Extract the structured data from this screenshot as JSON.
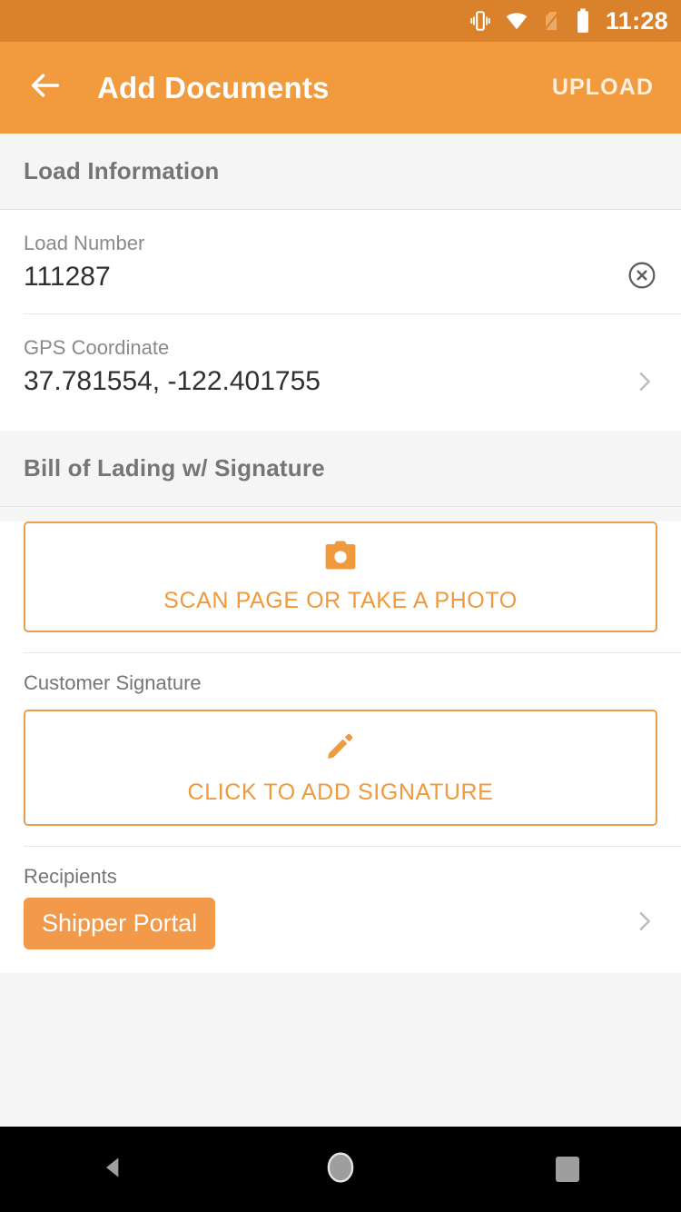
{
  "status_bar": {
    "time": "11:28",
    "icons": [
      "vibrate-icon",
      "wifi-icon",
      "no-sim-icon",
      "battery-icon"
    ],
    "background": "#d9822b"
  },
  "app_bar": {
    "back_icon": "back-arrow-icon",
    "title": "Add Documents",
    "action_label": "UPLOAD",
    "background": "#f29a3e"
  },
  "sections": {
    "load_information": {
      "header": "Load Information",
      "fields": [
        {
          "label": "Load Number",
          "value": "111287",
          "trailing_icon": "clear-circle-icon"
        },
        {
          "label": "GPS Coordinate",
          "value": "37.781554, -122.401755",
          "trailing_icon": "chevron-right-icon"
        }
      ]
    },
    "bill_of_lading": {
      "header": "Bill of Lading w/ Signature",
      "scan_button": {
        "icon": "camera-icon",
        "label": "SCAN PAGE OR TAKE A PHOTO"
      },
      "signature": {
        "label": "Customer Signature",
        "icon": "pencil-icon",
        "button_label": "CLICK TO ADD SIGNATURE"
      },
      "recipients": {
        "label": "Recipients",
        "chip": "Shipper Portal",
        "trailing_icon": "chevron-right-icon"
      }
    }
  },
  "nav_bar": {
    "back": "nav-back-icon",
    "home": "nav-home-icon",
    "recents": "nav-recents-icon"
  },
  "colors": {
    "accent": "#f2994a",
    "accent_dark": "#d9822b",
    "outline": "#e8a050",
    "section_bg": "#f5f5f5"
  }
}
